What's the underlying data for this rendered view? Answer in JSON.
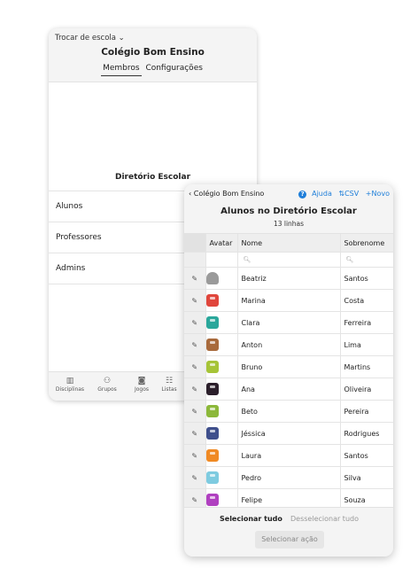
{
  "back": {
    "switch_school": "Trocar de escola ⌄",
    "school_name": "Colégio Bom Ensino",
    "tabs": [
      "Membros",
      "Configurações"
    ],
    "directory_label": "Diretório Escolar",
    "list": [
      "Alunos",
      "Professores",
      "Admins"
    ],
    "nav": [
      {
        "icon": "book-icon",
        "glyph": "▥",
        "label": "Disciplinas"
      },
      {
        "icon": "groups-icon",
        "glyph": "⚇",
        "label": "Grupos"
      },
      {
        "icon": "gamepad-icon",
        "glyph": "◙",
        "label": "Jogos"
      },
      {
        "icon": "list-icon",
        "glyph": "☷",
        "label": "Listas"
      }
    ]
  },
  "front": {
    "back_link": "‹ Colégio Bom Ensino",
    "help": "Ajuda",
    "csv": "⇅CSV",
    "new": "+Novo",
    "title": "Alunos no Diretório Escolar",
    "subtitle": "13 linhas",
    "columns": {
      "avatar": "Avatar",
      "name": "Nome",
      "surname": "Sobrenome"
    },
    "search_glyph": "🔍︎",
    "rows": [
      {
        "name": "Beatriz",
        "surname": "Santos",
        "avatar_color": "#9a9a9a",
        "default_avatar": true
      },
      {
        "name": "Marina",
        "surname": "Costa",
        "avatar_color": "#e0463c"
      },
      {
        "name": "Clara",
        "surname": "Ferreira",
        "avatar_color": "#2aa79b"
      },
      {
        "name": "Anton",
        "surname": "Lima",
        "avatar_color": "#a86a3c"
      },
      {
        "name": "Bruno",
        "surname": "Martins",
        "avatar_color": "#a6c437"
      },
      {
        "name": "Ana",
        "surname": "Oliveira",
        "avatar_color": "#2b1f2b"
      },
      {
        "name": "Beto",
        "surname": "Pereira",
        "avatar_color": "#8cb83a"
      },
      {
        "name": "Jéssica",
        "surname": "Rodrigues",
        "avatar_color": "#3f4f8c"
      },
      {
        "name": "Laura",
        "surname": "Santos",
        "avatar_color": "#f08a24"
      },
      {
        "name": "Pedro",
        "surname": "Silva",
        "avatar_color": "#7ecbe0"
      },
      {
        "name": "Felipe",
        "surname": "Souza",
        "avatar_color": "#b040c0"
      }
    ],
    "select_all": "Selecionar tudo",
    "deselect_all": "Desselecionar tudo",
    "select_action": "Selecionar ação"
  }
}
